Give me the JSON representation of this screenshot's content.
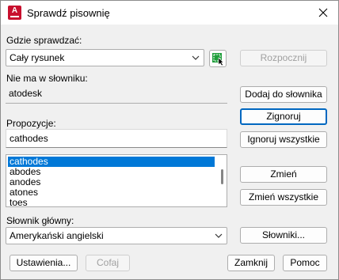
{
  "window": {
    "title": "Sprawdź pisownię",
    "close_icon": "close-icon",
    "app_icon": "autocad-icon",
    "app_icon_letter": "A"
  },
  "where": {
    "label": "Gdzie sprawdzać:",
    "value": "Cały rysunek",
    "select_objects_icon": "select-objects-icon"
  },
  "not_in_dictionary": {
    "label": "Nie ma w słowniku:",
    "value": "atodesk"
  },
  "suggestions": {
    "label": "Propozycje:",
    "value": "cathodes",
    "items": [
      "cathodes",
      "abodes",
      "anodes",
      "atones",
      "toes"
    ],
    "selected_index": 0
  },
  "main_dictionary": {
    "label": "Słownik główny:",
    "value": "Amerykański angielski"
  },
  "buttons": {
    "start": "Rozpocznij",
    "add_to_dictionary": "Dodaj do słownika",
    "ignore": "Zignoruj",
    "ignore_all": "Ignoruj wszystkie",
    "change": "Zmień",
    "change_all": "Zmień wszystkie",
    "dictionaries": "Słowniki...",
    "settings": "Ustawienia...",
    "undo": "Cofaj",
    "close": "Zamknij",
    "help": "Pomoc"
  },
  "colors": {
    "accent": "#0067c0",
    "selection": "#0078d7",
    "app_icon": "#c8102e",
    "select_icon": "#1e9e3a"
  }
}
